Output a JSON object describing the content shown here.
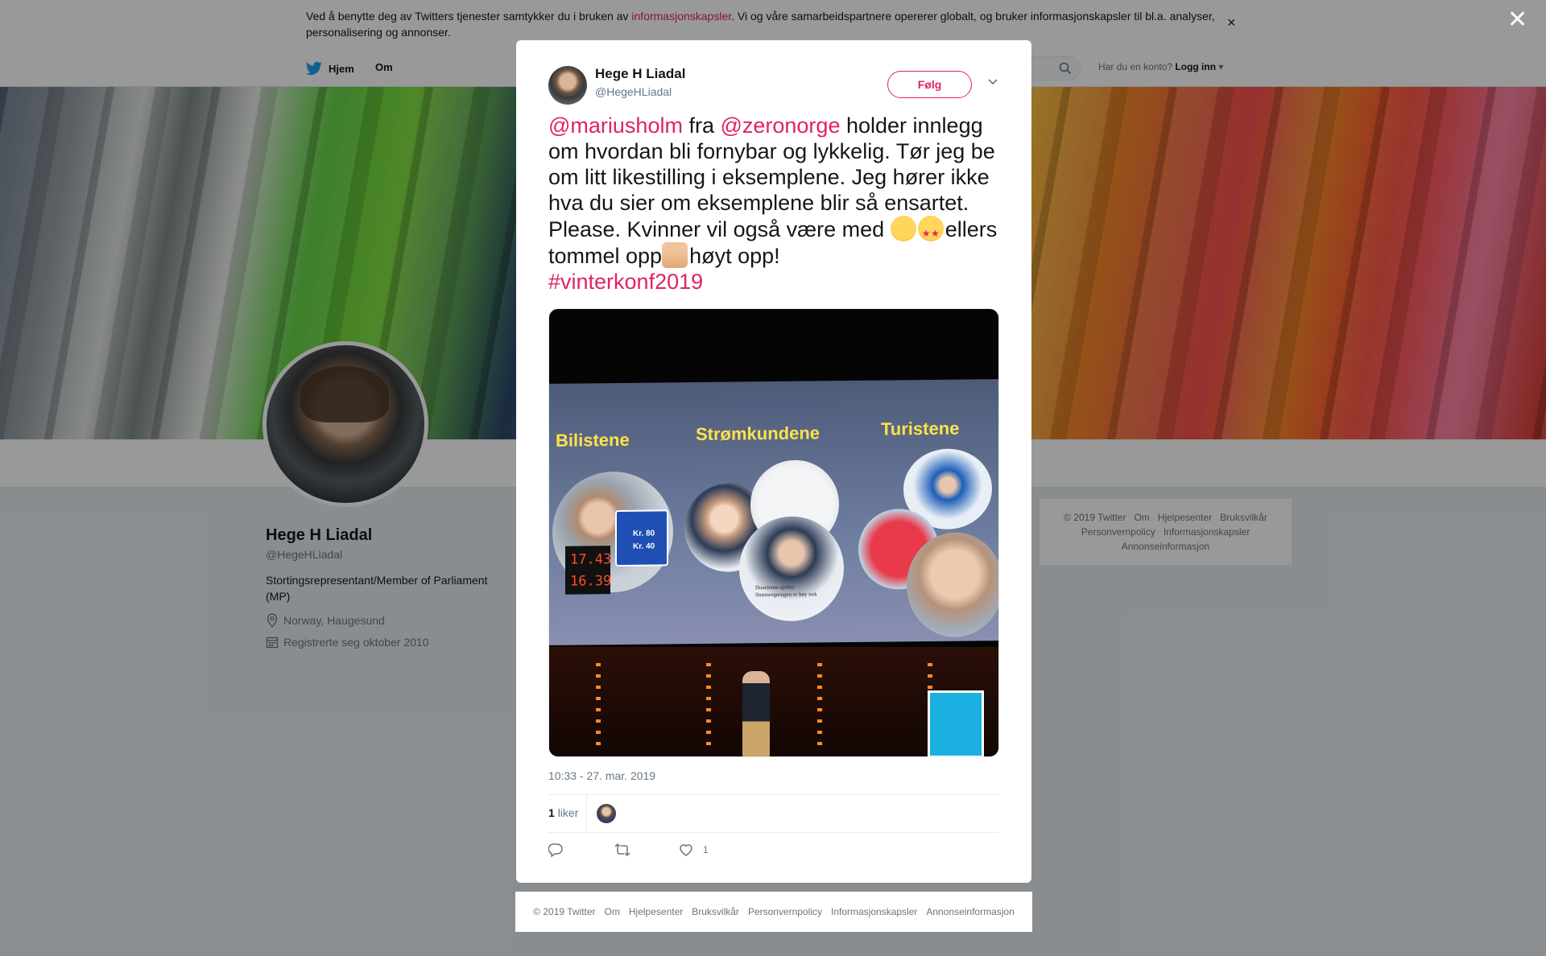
{
  "cookie": {
    "text_before": "Ved å benytte deg av Twitters tjenester samtykker du i bruken av ",
    "link": "informasjonskapsler",
    "text_after": ". Vi og våre samarbeidspartnere opererer globalt, og bruker informasjonskapsler til bl.a. analyser, personalisering og annonser."
  },
  "nav": {
    "home": "Hjem",
    "about": "Om",
    "login_prompt": "Har du en konto?",
    "login": "Logg inn"
  },
  "profile": {
    "name": "Hege H Liadal",
    "handle": "@HegeHLiadal",
    "bio": "Stortingsrepresentant/Member of Parliament (MP)",
    "location": "Norway, Haugesund",
    "joined": "Registrerte seg oktober 2010"
  },
  "side_footer": [
    "© 2019 Twitter",
    "Om",
    "Hjelpesenter",
    "Bruksvilkår",
    "Personvernpolicy",
    "Informasjonskapsler",
    "Annonseinformasjon"
  ],
  "tweet": {
    "author_name": "Hege H Liadal",
    "author_handle": "@HegeHLiadal",
    "follow": "Følg",
    "mention1": "@mariusholm",
    "t1": " fra ",
    "mention2": "@zeronorge",
    "t2": " holder innlegg om hvordan bli fornybar og lykkelig. Tør jeg be om litt likestilling i eksemplene. Jeg hører ikke hva du sier om eksemplene blir så ensartet. Please. Kvinner vil også være med ",
    "t3": "ellers tommel opp",
    "t4": "høyt opp!",
    "hashtag": "#vinterkonf2019",
    "emojis": [
      "worried-face-icon",
      "star-struck-face-icon",
      "thumbs-up-icon"
    ],
    "slide": {
      "labels": [
        "Bilistene",
        "Strømkundene",
        "Turistene"
      ],
      "sign_prices": [
        "Kr. 80",
        "Kr. 40"
      ],
      "pump_prices": [
        "17.43",
        "16.39"
      ],
      "news_caption": "Huseierne-sjefen: Strømregningen er høy nok"
    },
    "timestamp": "10:33 - 27. mar. 2019",
    "like_count": "1",
    "like_label": "liker",
    "action_like_count": "1"
  },
  "modal_footer": [
    "© 2019 Twitter",
    "Om",
    "Hjelpesenter",
    "Bruksvilkår",
    "Personvernpolicy",
    "Informasjonskapsler",
    "Annonseinformasjon"
  ],
  "colors": {
    "accent": "#e0245e",
    "text": "#14171a",
    "muted": "#657786",
    "bg": "#e6ecf0"
  }
}
